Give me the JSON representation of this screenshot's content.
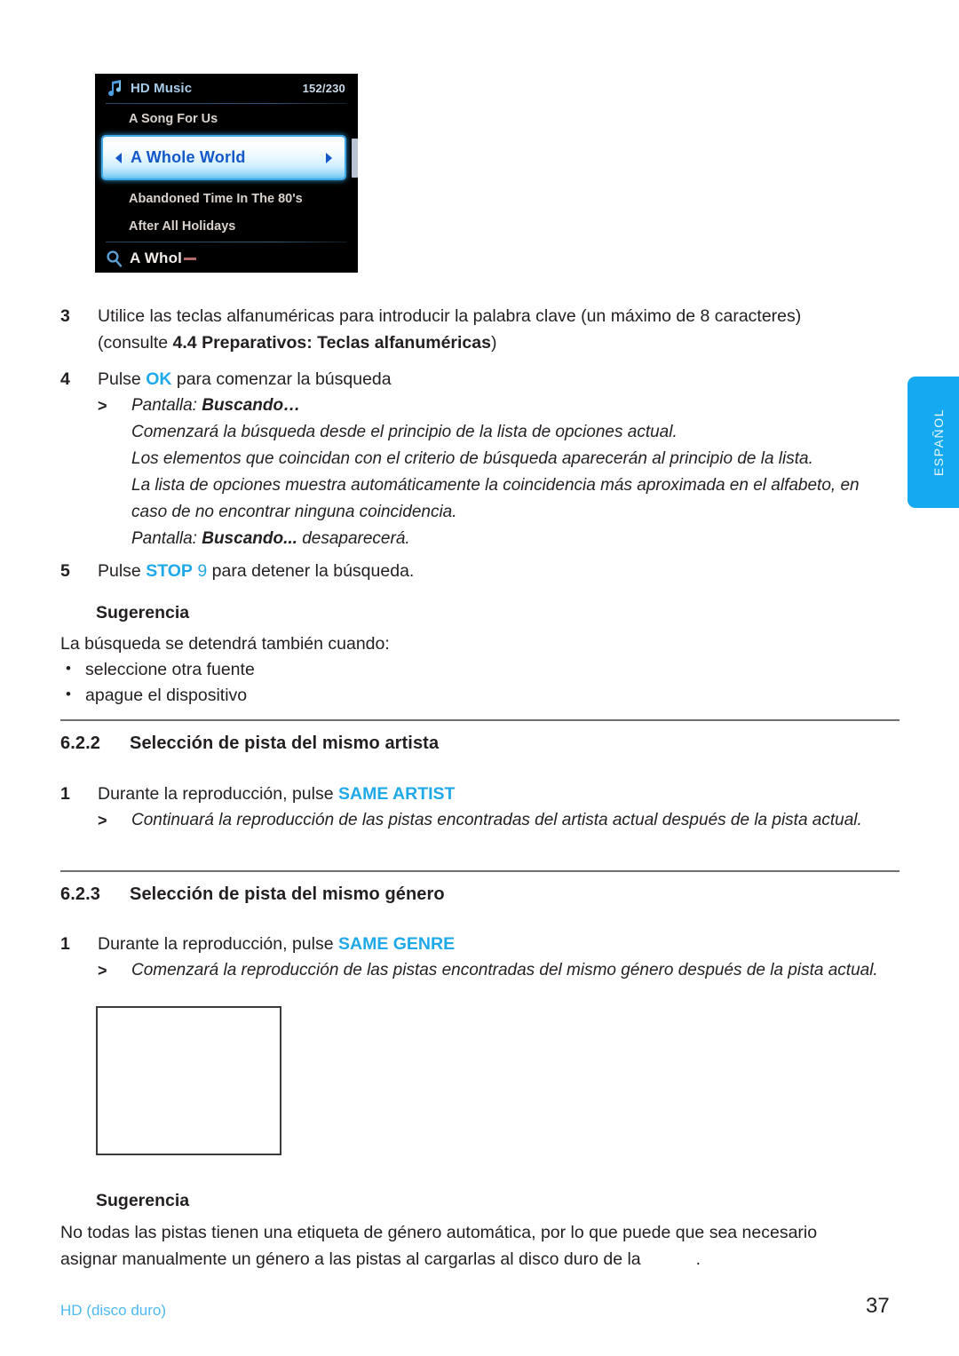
{
  "document": {
    "language_tab": "ESPAÑOL",
    "footer_section": "HD (disco duro)",
    "page_number": "37",
    "accent_color": "#1fa9e8",
    "rule_color": "#6d6e71"
  },
  "lcd_figure": {
    "header_title": "HD Music",
    "header_count": "152/230",
    "music_note_icon": "music-note-icon",
    "search_icon": "magnifier-icon",
    "rows": [
      {
        "label": "A Song For Us",
        "selected": false
      },
      {
        "label": "A Whole World",
        "selected": true
      },
      {
        "label": "Abandoned Time In The 80's",
        "selected": false
      },
      {
        "label": "After All Holidays",
        "selected": false
      }
    ],
    "search_query": "A Whol",
    "left_arrow_icon": "triangle-left-icon",
    "right_arrow_icon": "triangle-right-icon"
  },
  "steps": {
    "step3": {
      "number": "3",
      "line1": "Utilice las teclas alfanuméricas para introducir la palabra clave (un máximo de 8 caracteres)",
      "line2_prefix": "(consulte ",
      "line2_bold": "4.4 Preparativos: Teclas alfanuméricas",
      "line2_suffix": ")"
    },
    "step4": {
      "number": "4",
      "prefix": "Pulse ",
      "key": "OK",
      "suffix": " para comenzar la búsqueda",
      "gt": ">",
      "note_label": "Pantalla: ",
      "note_bold": "Buscando…"
    },
    "step4_paragraph": {
      "line1": "Comenzará la búsqueda desde el principio de la lista de opciones actual.",
      "line2": "Los elementos que coincidan con el criterio de búsqueda aparecerán al principio de la lista.",
      "line3": "La lista de opciones muestra automáticamente la coincidencia más aproximada en el alfabeto, en",
      "line4": "caso de no encontrar ninguna coincidencia.",
      "line5_prefix": "Pantalla: ",
      "line5_bold": "Buscando...",
      "line5_suffix": " desaparecerá."
    },
    "step5": {
      "number": "5",
      "prefix": "Pulse ",
      "key": "STOP",
      "key_num": "9",
      "suffix": " para detener la búsqueda."
    }
  },
  "tip1": {
    "title": "Sugerencia",
    "intro": "La búsqueda se detendrá también cuando:",
    "bullets": [
      "seleccione otra fuente",
      "apague el dispositivo"
    ],
    "bullet_glyph": "•"
  },
  "section_622": {
    "number": "6.2.2",
    "title": "Selección de pista del mismo artista",
    "step_number": "1",
    "step_prefix": "Durante la reproducción, pulse ",
    "step_key": "SAME ARTIST",
    "gt": ">",
    "result": "Continuará la reproducción de las pistas encontradas del artista actual después de la pista actual."
  },
  "section_623": {
    "number": "6.2.3",
    "title": "Selección de pista del mismo género",
    "step_number": "1",
    "step_prefix": "Durante la reproducción, pulse ",
    "step_key": "SAME GENRE",
    "gt": ">",
    "result": "Comenzará la reproducción de las pistas encontradas del mismo género después de la pista actual."
  },
  "tip2": {
    "title": "Sugerencia",
    "line1": "No todas las pistas tienen una etiqueta de género automática, por lo que puede que sea necesario",
    "line2_before": "asignar manualmente un género a las pistas al cargarlas al disco duro de la",
    "line2_after": "."
  }
}
